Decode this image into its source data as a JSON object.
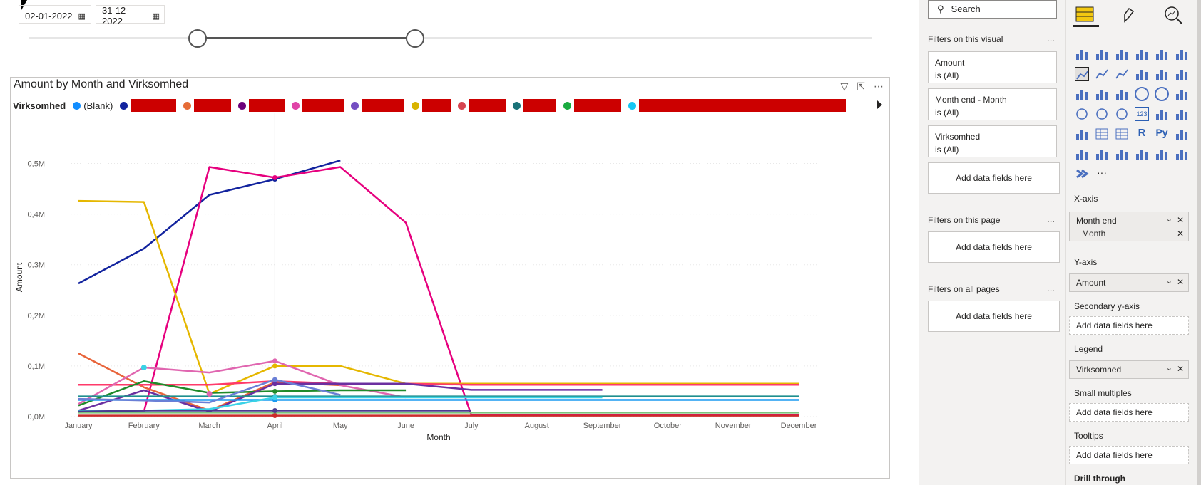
{
  "slicer": {
    "start_date": "02-01-2022",
    "end_date": "31-12-2022",
    "start_fraction": 0,
    "end_fraction": 1
  },
  "visual": {
    "title": "Amount by Month and Virksomhed",
    "legend_title": "Virksomhed",
    "legend_first": "(Blank)"
  },
  "chart_data": {
    "type": "line",
    "title": "Amount by Month and Virksomhed",
    "xlabel": "Month",
    "ylabel": "Amount",
    "ylim": [
      0,
      0.55
    ],
    "y_unit": "M",
    "yticks": [
      "0,0M",
      "0,1M",
      "0,2M",
      "0,3M",
      "0,4M",
      "0,5M"
    ],
    "categories": [
      "January",
      "February",
      "March",
      "April",
      "May",
      "June",
      "July",
      "August",
      "September",
      "October",
      "November",
      "December"
    ],
    "legend_position": "top",
    "grid": true,
    "series": [
      {
        "color": "#12239e",
        "values": [
          0.263,
          0.332,
          0.438,
          0.469,
          0.506,
          null,
          null,
          null,
          null,
          null,
          null,
          null
        ]
      },
      {
        "color": "#e6007e",
        "values": [
          0.01,
          0.01,
          0.493,
          0.472,
          0.493,
          0.383,
          0.003,
          0.003,
          0.003,
          0.003,
          0.003,
          0.003
        ]
      },
      {
        "color": "#e5b700",
        "values": [
          0.426,
          0.424,
          0.045,
          0.1,
          0.1,
          0.065,
          0.065,
          0.065,
          0.065,
          0.065,
          0.065,
          0.065
        ]
      },
      {
        "color": "#e8643a",
        "values": [
          0.125,
          0.058,
          0.012,
          0.068,
          0.062,
          null,
          null,
          null,
          null,
          null,
          null,
          null
        ]
      },
      {
        "color": "#ff3a6a",
        "values": [
          0.063,
          0.063,
          0.063,
          0.07,
          0.065,
          0.065,
          0.063,
          0.063,
          0.063,
          0.063,
          0.063,
          0.063
        ]
      },
      {
        "color": "#e066b0",
        "values": [
          0.025,
          0.097,
          0.087,
          0.11,
          0.062,
          0.038,
          null,
          null,
          null,
          null,
          null,
          null
        ]
      },
      {
        "color": "#208a2a",
        "values": [
          0.022,
          0.07,
          0.047,
          0.05,
          0.052,
          0.052,
          null,
          null,
          null,
          null,
          null,
          null
        ]
      },
      {
        "color": "#6b2fa0",
        "values": [
          0.012,
          0.052,
          0.01,
          0.065,
          0.065,
          0.065,
          0.053,
          0.053,
          0.053,
          null,
          null,
          null
        ]
      },
      {
        "color": "#1f8f8f",
        "values": [
          0.04,
          0.04,
          0.04,
          0.04,
          0.04,
          0.04,
          0.04,
          0.04,
          0.04,
          0.04,
          0.04,
          0.04
        ]
      },
      {
        "color": "#1a9af0",
        "values": [
          0.033,
          0.033,
          0.033,
          0.033,
          0.033,
          0.033,
          0.033,
          0.033,
          0.033,
          0.033,
          0.033,
          0.033
        ]
      },
      {
        "color": "#6a7fd6",
        "values": [
          0.035,
          0.032,
          0.028,
          0.073,
          0.043,
          null,
          null,
          null,
          null,
          null,
          null,
          null
        ]
      },
      {
        "color": "#3ad2e6",
        "values": [
          0.012,
          0.012,
          0.015,
          0.038,
          0.038,
          0.038,
          0.038,
          0.038,
          0.038,
          null,
          null,
          null
        ]
      },
      {
        "color": "#7cc47c",
        "values": [
          0.008,
          0.008,
          0.008,
          0.008,
          0.008,
          0.008,
          0.008,
          0.008,
          0.008,
          0.008,
          0.008,
          0.008
        ]
      },
      {
        "color": "#4b3b8f",
        "values": [
          0.01,
          0.012,
          0.012,
          0.012,
          0.012,
          0.012,
          0.012,
          null,
          null,
          null,
          null,
          null
        ]
      },
      {
        "color": "#cc2b2b",
        "values": [
          0.002,
          0.002,
          0.002,
          0.002,
          0.002,
          0.002,
          0.002,
          0.002,
          0.002,
          0.002,
          0.002,
          0.002
        ]
      }
    ],
    "hover_category": "April"
  },
  "legend_dots": [
    "#118dff",
    "#12239e",
    "#e66c37",
    "#6b007b",
    "#e044a7",
    "#744ec2",
    "#d9b300",
    "#d64550",
    "#197278",
    "#1aab40",
    "#15c6f4"
  ],
  "filters": {
    "search_placeholder": "Search",
    "on_visual_label": "Filters on this visual",
    "on_page_label": "Filters on this page",
    "on_all_label": "Filters on all pages",
    "more": "...",
    "cards": [
      {
        "name": "Amount",
        "state": "is (All)"
      },
      {
        "name": "Month end - Month",
        "state": "is (All)"
      },
      {
        "name": "Virksomhed",
        "state": "is (All)"
      }
    ],
    "add_label": "Add data fields here"
  },
  "viz": {
    "more": "···",
    "wells": {
      "xaxis_label": "X-axis",
      "xaxis_field1": "Month end",
      "xaxis_field2": "Month",
      "yaxis_label": "Y-axis",
      "yaxis_field": "Amount",
      "secondary_label": "Secondary y-axis",
      "legend_label": "Legend",
      "legend_field": "Virksomhed",
      "small_multiples_label": "Small multiples",
      "tooltips_label": "Tooltips",
      "drill_label": "Drill through",
      "add_label": "Add data fields here"
    },
    "icon_chars": {
      "r_icon": "R",
      "py_icon": "Py",
      "card_icon": "123"
    }
  }
}
